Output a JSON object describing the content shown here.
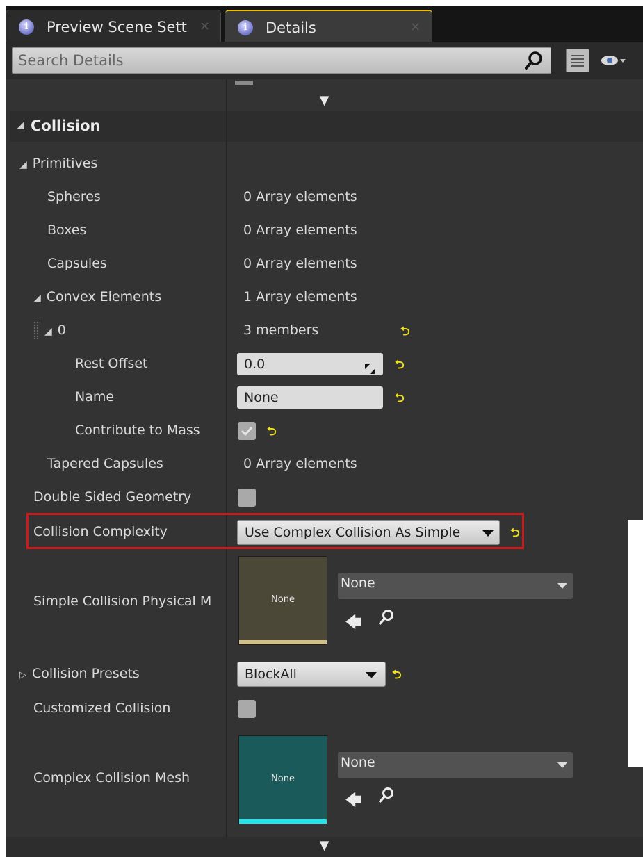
{
  "tabs": [
    {
      "label": "Preview Scene Sett",
      "icon": "info-icon",
      "close": "×"
    },
    {
      "label": "Details",
      "icon": "info-icon",
      "close": "×"
    }
  ],
  "search": {
    "placeholder": "Search Details"
  },
  "section": {
    "title": "Collision"
  },
  "rows": {
    "primitives": {
      "label": "Primitives"
    },
    "spheres": {
      "label": "Spheres",
      "value": "0 Array elements"
    },
    "boxes": {
      "label": "Boxes",
      "value": "0 Array elements"
    },
    "capsules": {
      "label": "Capsules",
      "value": "0 Array elements"
    },
    "convex": {
      "label": "Convex Elements",
      "value": "1 Array elements"
    },
    "element0": {
      "label": "0",
      "value": "3 members"
    },
    "rest_offset": {
      "label": "Rest Offset",
      "value": "0.0"
    },
    "name": {
      "label": "Name",
      "value": "None"
    },
    "contribute": {
      "label": "Contribute to Mass",
      "checked": true
    },
    "tapered": {
      "label": "Tapered Capsules",
      "value": "0 Array elements"
    },
    "double_sided": {
      "label": "Double Sided Geometry",
      "checked": false
    },
    "complexity": {
      "label": "Collision Complexity",
      "value": "Use Complex Collision As Simple"
    },
    "phys_material": {
      "label": "Simple Collision Physical M",
      "thumb": "None",
      "asset": "None"
    },
    "presets": {
      "label": "Collision Presets",
      "value": "BlockAll"
    },
    "customized": {
      "label": "Customized Collision",
      "checked": false
    },
    "complex_mesh": {
      "label": "Complex Collision Mesh",
      "thumb": "None",
      "asset": "None"
    }
  },
  "colors": {
    "highlight": "#cc1a1a",
    "reset_arrow": "#f2e21a",
    "accent_tab": "#f0c000"
  }
}
